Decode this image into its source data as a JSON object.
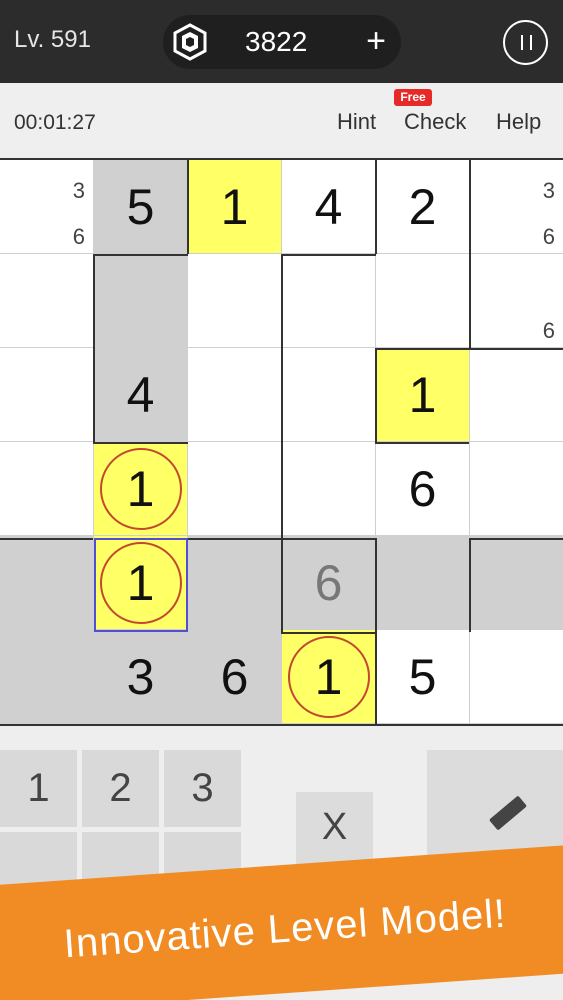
{
  "header": {
    "level": "Lv. 591",
    "coins": "3822",
    "add_label": "+"
  },
  "toolbar": {
    "timer": "00:01:27",
    "hint": "Hint",
    "check": "Check",
    "help": "Help",
    "free_badge": "Free"
  },
  "board": {
    "cells": [
      {
        "id": "r0c0",
        "notes": "3\n6"
      },
      {
        "id": "r0c1",
        "value": "5"
      },
      {
        "id": "r0c2",
        "value": "1"
      },
      {
        "id": "r0c3",
        "value": "4"
      },
      {
        "id": "r0c4",
        "value": "2"
      },
      {
        "id": "r0c5",
        "notes": "3\n6"
      },
      {
        "id": "r1c5",
        "notes": "6"
      },
      {
        "id": "r2c1",
        "value": "4"
      },
      {
        "id": "r2c4",
        "value": "1"
      },
      {
        "id": "r3c1",
        "value": "1"
      },
      {
        "id": "r3c4",
        "value": "6"
      },
      {
        "id": "r4c1",
        "value": "1"
      },
      {
        "id": "r4c3",
        "value": "6"
      },
      {
        "id": "r5c1",
        "value": "3"
      },
      {
        "id": "r5c2",
        "value": "6"
      },
      {
        "id": "r5c3",
        "value": "1"
      },
      {
        "id": "r5c4",
        "value": "5"
      }
    ]
  },
  "keypad": {
    "keys": [
      "1",
      "2",
      "3"
    ],
    "erase": "X"
  },
  "banner": {
    "text": "Innovative Level Model!"
  },
  "colors": {
    "highlight": "#ffff66",
    "shade": "#d0d0d0",
    "ring": "#c2492f",
    "selected_border": "#5050d0",
    "banner": "#f08c23"
  }
}
